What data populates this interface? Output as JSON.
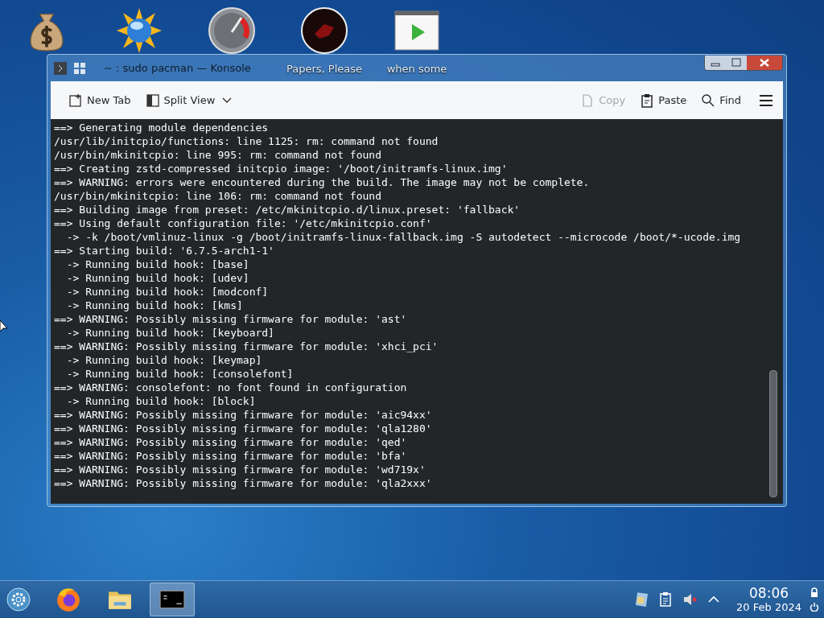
{
  "desktop_icons": [
    {
      "kind": "money"
    },
    {
      "kind": "sun"
    },
    {
      "kind": "gauge"
    },
    {
      "kind": "dark",
      "label": "Papers, Please"
    },
    {
      "kind": "play",
      "label": "when some"
    }
  ],
  "window": {
    "title": "~ : sudo pacman — Konsole"
  },
  "toolbar": {
    "left": [
      {
        "label": "New Tab",
        "kind": "newtab"
      },
      {
        "label": "Split View",
        "kind": "split"
      }
    ],
    "right": [
      {
        "label": "Copy",
        "kind": "copy",
        "disabled": true
      },
      {
        "label": "Paste",
        "kind": "paste",
        "disabled": false
      },
      {
        "label": "Find",
        "kind": "find",
        "disabled": false
      }
    ]
  },
  "terminal_lines": [
    "==> Generating module dependencies",
    "/usr/lib/initcpio/functions: line 1125: rm: command not found",
    "/usr/bin/mkinitcpio: line 995: rm: command not found",
    "==> Creating zstd-compressed initcpio image: '/boot/initramfs-linux.img'",
    "==> WARNING: errors were encountered during the build. The image may not be complete.",
    "/usr/bin/mkinitcpio: line 106: rm: command not found",
    "==> Building image from preset: /etc/mkinitcpio.d/linux.preset: 'fallback'",
    "==> Using default configuration file: '/etc/mkinitcpio.conf'",
    "  -> -k /boot/vmlinuz-linux -g /boot/initramfs-linux-fallback.img -S autodetect --microcode /boot/*-ucode.img",
    "==> Starting build: '6.7.5-arch1-1'",
    "  -> Running build hook: [base]",
    "  -> Running build hook: [udev]",
    "  -> Running build hook: [modconf]",
    "  -> Running build hook: [kms]",
    "==> WARNING: Possibly missing firmware for module: 'ast'",
    "  -> Running build hook: [keyboard]",
    "==> WARNING: Possibly missing firmware for module: 'xhci_pci'",
    "  -> Running build hook: [keymap]",
    "  -> Running build hook: [consolefont]",
    "==> WARNING: consolefont: no font found in configuration",
    "  -> Running build hook: [block]",
    "==> WARNING: Possibly missing firmware for module: 'aic94xx'",
    "==> WARNING: Possibly missing firmware for module: 'qla1280'",
    "==> WARNING: Possibly missing firmware for module: 'qed'",
    "==> WARNING: Possibly missing firmware for module: 'bfa'",
    "==> WARNING: Possibly missing firmware for module: 'wd719x'",
    "==> WARNING: Possibly missing firmware for module: 'qla2xxx'"
  ],
  "taskbar": {
    "apps": [
      {
        "kind": "firefox",
        "selected": false
      },
      {
        "kind": "files",
        "selected": false
      },
      {
        "kind": "terminal",
        "selected": true
      }
    ],
    "time": "08:06",
    "date": "20 Feb 2024",
    "volume_muted": true
  }
}
